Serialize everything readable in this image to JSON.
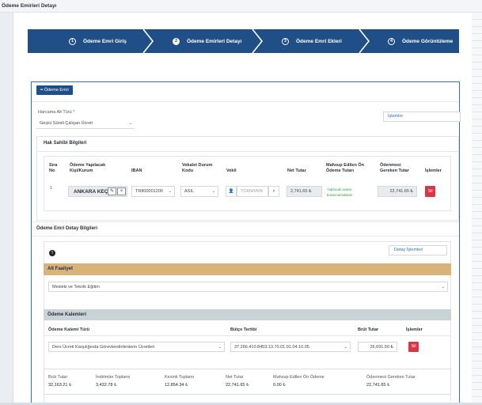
{
  "page_title": "Ödeme Emirleri Detayı",
  "steps": [
    {
      "num": "1",
      "label": "Ödeme Emri Giriş"
    },
    {
      "num": "2",
      "label": "Ödeme Emirleri Detayı"
    },
    {
      "num": "3",
      "label": "Ödeme Emri Ekleri"
    },
    {
      "num": "4",
      "label": "Ödeme Görüntüleme"
    }
  ],
  "colors": {
    "stepper": "#1f4f86",
    "active_step": "2",
    "alt_faaliyet_header": "#d8b37c",
    "kalem_header": "#c9d3d5",
    "danger": "#dc3545",
    "accent_border": "#2e70b8"
  },
  "odeme_emri_button": "Ödeme Emri",
  "harcama": {
    "label": "Harcama Alt Türü",
    "required_mark": "*",
    "value": "Geçici Süreli Çalışan Ücreti"
  },
  "islemler_button": "İşlemler",
  "hak_sahibi": {
    "title": "Hak Sahibi Bilgileri",
    "headers": {
      "sira": "Sıra\nNo",
      "kisi": "Ödeme Yapılacak\nKişi/Kurum",
      "iban": "IBAN",
      "vekalet": "Vekalet Durum\nKodu",
      "vekil": "Vekil",
      "net": "Net Tutar",
      "mahsup": "Mahsup Edilen Ön\nÖdeme Tutarı",
      "odenmesi": "Ödenmesi\nGereken Tutar",
      "islemler": "İşlemler"
    },
    "row": {
      "sira": "1",
      "kisi": "ANKARA KEÇİÖ",
      "iban": "TR800001200",
      "vekalet": "ASIL",
      "vekil_placeholder": "TCKN/VKN",
      "net": "2,741.65",
      "mahsup_note": "Yapılacak avansı bulunmamaktadır",
      "odenmesi": "22,741.65",
      "delete": "Sil"
    }
  },
  "detay": {
    "title": "Ödeme Emri Detay Bilgileri",
    "detay_islemleri": "Detay İşlemleri",
    "alt_faaliyet": {
      "title": "Alt Faaliyet",
      "value": "Mesleki ve Teknik Eğitim"
    },
    "kalemleri": {
      "title": "Ödeme Kalemleri",
      "headers": {
        "tur": "Ödeme Kalemi Türü",
        "butce": "Bütçe Tertibi",
        "brut": "Brüt Tutar",
        "islemler": "İşlemler"
      },
      "row": {
        "tur": "Ders Ücreti Karşılığında Görevlendirilenlerin Ücretleri",
        "butce": "37.266.410.8453.13.70.01.01.04.10.05",
        "brut": "26,691.50",
        "delete": "Sil"
      }
    },
    "summary": [
      {
        "label": "Brüt Tutar",
        "value": "32,163.21"
      },
      {
        "label": "İndirimler Toplamı",
        "value": "3,432.78"
      },
      {
        "label": "Kesinti Toplamı",
        "value": "12,854.34"
      },
      {
        "label": "Net Tutar",
        "value": "22,741.65"
      },
      {
        "label": "Mahsup Edilen Ön Ödeme",
        "value": "0.00"
      },
      {
        "label": "Ödenmesi Gereken Tutar",
        "value": "22,741.65"
      }
    ]
  },
  "currency": "₺",
  "info_glyph": "!"
}
